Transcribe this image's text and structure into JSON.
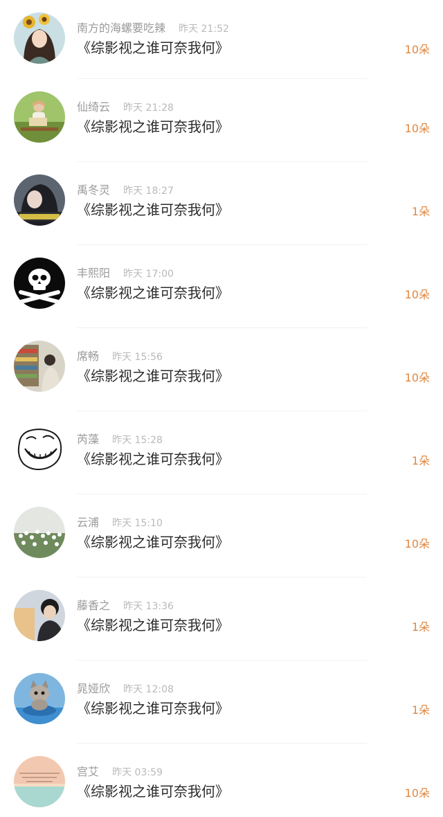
{
  "gifts": [
    {
      "name": "南方的海螺要吃辣",
      "time": "昨天 21:52",
      "title": "《综影视之谁可奈我何》",
      "count": "10朵",
      "avatar": "girl-sunflower-avatar"
    },
    {
      "name": "仙绮云",
      "time": "昨天 21:28",
      "title": "《综影视之谁可奈我何》",
      "count": "10朵",
      "avatar": "child-reading-avatar"
    },
    {
      "name": "禹冬灵",
      "time": "昨天 18:27",
      "title": "《综影视之谁可奈我何》",
      "count": "1朵",
      "avatar": "girl-caption-avatar"
    },
    {
      "name": "丰熙阳",
      "time": "昨天 17:00",
      "title": "《综影视之谁可奈我何》",
      "count": "10朵",
      "avatar": "skull-avatar"
    },
    {
      "name": "席畅",
      "time": "昨天 15:56",
      "title": "《综影视之谁可奈我何》",
      "count": "10朵",
      "avatar": "store-shelf-avatar"
    },
    {
      "name": "芮藻",
      "time": "昨天 15:28",
      "title": "《综影视之谁可奈我何》",
      "count": "1朵",
      "avatar": "trollface-avatar"
    },
    {
      "name": "云浦",
      "time": "昨天 15:10",
      "title": "《综影视之谁可奈我何》",
      "count": "10朵",
      "avatar": "white-flowers-avatar"
    },
    {
      "name": "藤香之",
      "time": "昨天 13:36",
      "title": "《综影视之谁可奈我何》",
      "count": "1朵",
      "avatar": "boy-portrait-avatar"
    },
    {
      "name": "晁娅欣",
      "time": "昨天 12:08",
      "title": "《综影视之谁可奈我何》",
      "count": "1朵",
      "avatar": "kitten-avatar"
    },
    {
      "name": "宫艾",
      "time": "昨天 03:59",
      "title": "《综影视之谁可奈我何》",
      "count": "10朵",
      "avatar": "sunset-text-avatar"
    }
  ],
  "colors": {
    "count": "#e0863f",
    "title": "#2b2b2b",
    "name": "#9a9a9a",
    "time": "#b9b9b9"
  }
}
